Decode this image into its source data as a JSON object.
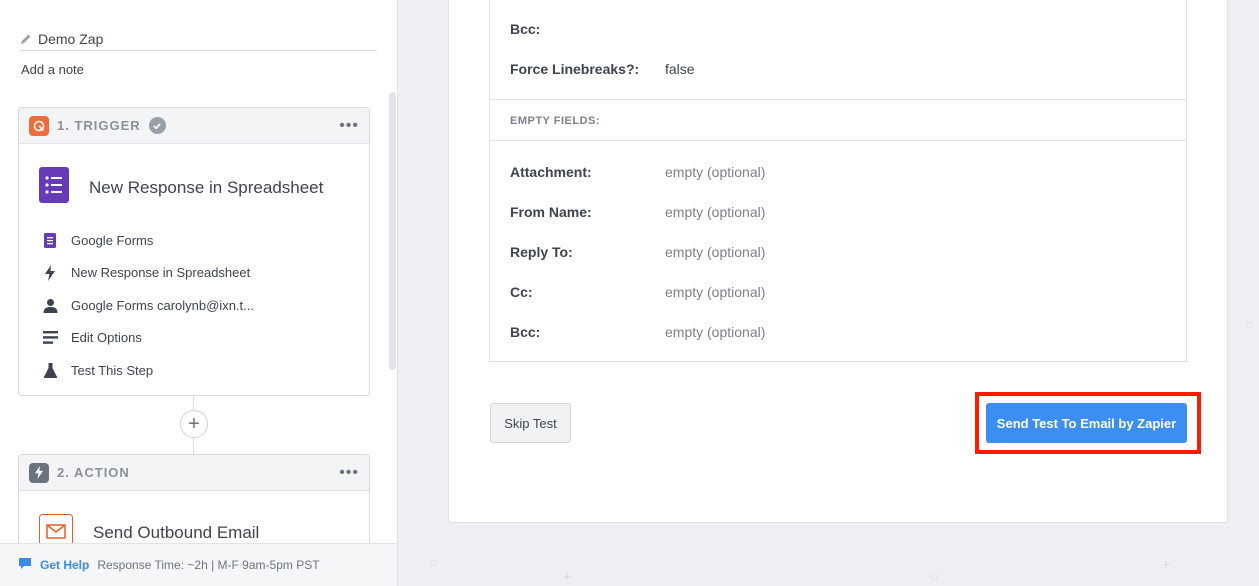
{
  "sidebar": {
    "zap_name": "Demo Zap",
    "add_note": "Add a note",
    "trigger": {
      "label": "1. TRIGGER",
      "app_title": "New Response in Spreadsheet",
      "steps": [
        {
          "icon": "google-forms-icon",
          "label": "Google Forms"
        },
        {
          "icon": "lightning-icon",
          "label": "New Response in Spreadsheet"
        },
        {
          "icon": "user-icon",
          "label": "Google Forms carolynb@ixn.t..."
        },
        {
          "icon": "list-icon",
          "label": "Edit Options"
        },
        {
          "icon": "flask-icon",
          "label": "Test This Step"
        }
      ]
    },
    "action": {
      "label": "2. ACTION",
      "app_title": "Send Outbound Email"
    },
    "help": {
      "link": "Get Help",
      "response_time": "Response Time: ~2h | M-F 9am-5pm PST"
    }
  },
  "main": {
    "filled_fields": [
      {
        "key": "Bcc:",
        "value": ""
      },
      {
        "key": "Force Linebreaks?:",
        "value": "false"
      }
    ],
    "empty_header": "EMPTY FIELDS:",
    "empty_fields": [
      {
        "key": "Attachment:",
        "value": "empty (optional)"
      },
      {
        "key": "From Name:",
        "value": "empty (optional)"
      },
      {
        "key": "Reply To:",
        "value": "empty (optional)"
      },
      {
        "key": "Cc:",
        "value": "empty (optional)"
      },
      {
        "key": "Bcc:",
        "value": "empty (optional)"
      }
    ],
    "skip_button": "Skip Test",
    "send_button": "Send Test To Email by Zapier"
  },
  "colors": {
    "accent": "#3d8ef2",
    "highlight": "#ff1a00",
    "trigger_badge": "#f26b3a",
    "action_badge": "#6b7280",
    "forms_purple": "#673ab7"
  }
}
